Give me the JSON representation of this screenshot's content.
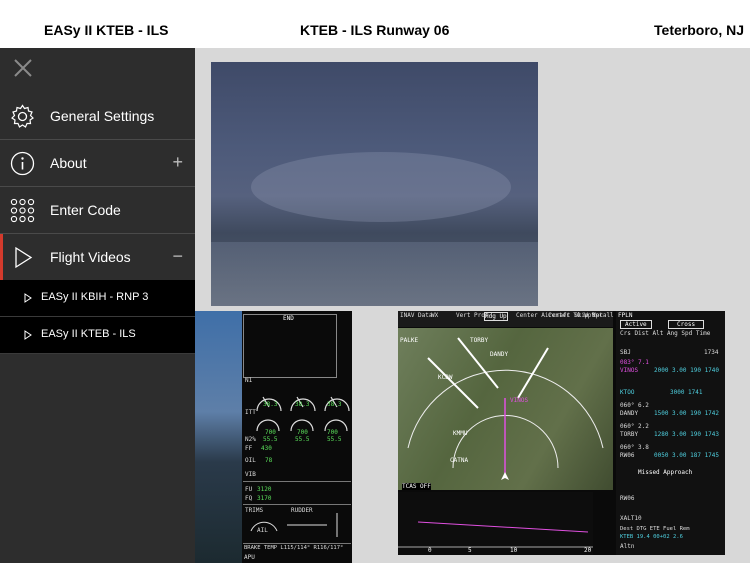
{
  "header": {
    "left": "EASy II KTEB - ILS",
    "center": "KTEB - ILS Runway 06",
    "right": "Teterboro, NJ"
  },
  "sidebar": {
    "close_icon": "close-icon",
    "items": [
      {
        "label": "General Settings",
        "icon": "gear-icon",
        "toggle": ""
      },
      {
        "label": "About",
        "icon": "info-icon",
        "toggle": "+"
      },
      {
        "label": "Enter Code",
        "icon": "keypad-icon",
        "toggle": ""
      },
      {
        "label": "Flight Videos",
        "icon": "play-icon",
        "toggle": "−"
      }
    ],
    "sub_items": [
      {
        "label": "EASy II KBIH - RNP 3"
      },
      {
        "label": "EASy II KTEB - ILS"
      }
    ],
    "active_color": "#d33a2c"
  },
  "eicas": {
    "end": "END",
    "n1": "N1",
    "itt": "ITT",
    "n2": "N2%",
    "oil": "OIL",
    "vib": "VIB",
    "fu": "FU",
    "fq": "FQ",
    "trims": "TRIMS",
    "ail": "AIL",
    "rudder": "RUDDER",
    "brake": "BRAKE TEMP L115/114° R116/117°",
    "apu": "APU",
    "vals": {
      "n1a": "38.3",
      "n1b": "38.3",
      "n1c": "38.3",
      "itt": "700",
      "n2": "55.5",
      "ff": "430",
      "oil": "78",
      "fu": "3120",
      "fq": "3170"
    }
  },
  "mfd": {
    "tabs": [
      "INAV Data",
      "WX",
      "Vert Prof",
      "Hdg Up",
      "Center Aircraft",
      "Center TO Wpt",
      "Skip Wpt",
      "Recall Wpt"
    ],
    "fpln_title": "FPLN",
    "fpln_tabs": [
      "Active",
      "Cross"
    ],
    "fpln_header": "Crs  Dist  Alt  Ang Spd Time",
    "fpln_rows": [
      {
        "wpt": "SBJ",
        "crs": "",
        "data": "1734"
      },
      {
        "wpt": "VINOS",
        "crs": "083° 7.1",
        "data": "2000 3.00 190 1740"
      },
      {
        "wpt": "KTOO",
        "crs": "",
        "data": "3000 1741"
      },
      {
        "wpt": "DANDY",
        "crs": "060° 6.2",
        "data": "1500 3.00 190 1742"
      },
      {
        "wpt": "TORBY",
        "crs": "060° 2.2",
        "data": "1280 3.00 190 1743"
      },
      {
        "wpt": "RW06",
        "crs": "060° 3.8",
        "data": "0050 3.00 187 1745"
      }
    ],
    "missed": "Missed Approach",
    "rw06": "RW06",
    "xalt": "XALT10",
    "dest_labels": "Dest  DTG  ETE  Fuel Rem",
    "dest_vals": "KTEB  19.4 00+02  2.6",
    "altn": "Altn",
    "map_labels": [
      "PALKE",
      "TORBY",
      "DANDY",
      "KCDW",
      "VINOS",
      "KMMU",
      "CATNA"
    ],
    "tcas": "TCAS OFF",
    "scale": [
      "0",
      "5",
      "10",
      "20"
    ]
  }
}
